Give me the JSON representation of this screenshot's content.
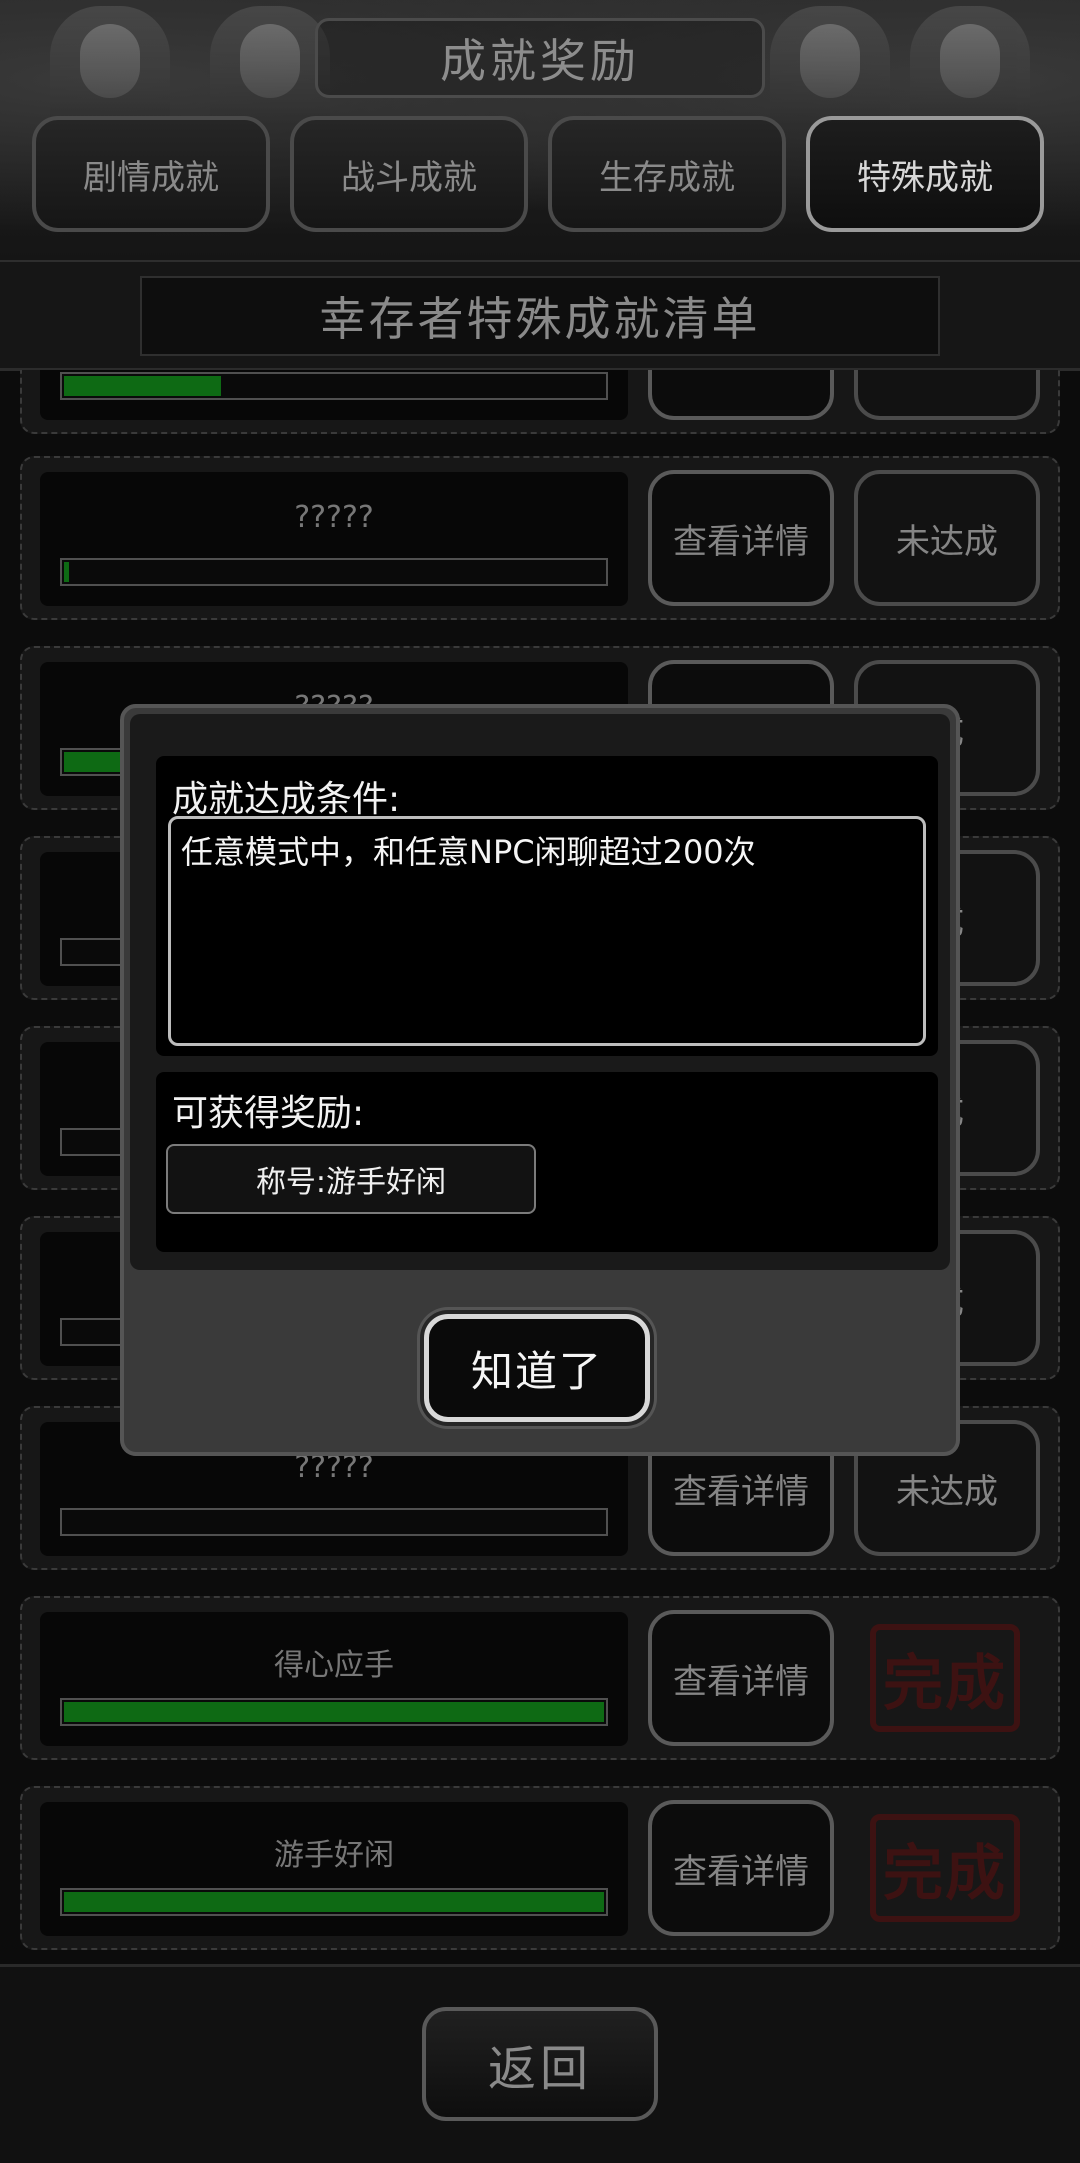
{
  "header": {
    "title": "成就奖励",
    "tabs": [
      {
        "label": "剧情成就",
        "active": false
      },
      {
        "label": "战斗成就",
        "active": false
      },
      {
        "label": "生存成就",
        "active": false
      },
      {
        "label": "特殊成就",
        "active": true
      }
    ],
    "subtitle": "幸存者特殊成就清单"
  },
  "list": {
    "rows": [
      {
        "name": "",
        "progress": 0.29,
        "detail_label": "",
        "status_label": ""
      },
      {
        "name": "?????",
        "progress": 0.01,
        "detail_label": "查看详情",
        "status_label": "未达成"
      },
      {
        "name": "?????",
        "progress": 0.32,
        "detail_label": "",
        "status_label": "成"
      },
      {
        "name": "",
        "progress": 0.0,
        "detail_label": "",
        "status_label": "成"
      },
      {
        "name": "",
        "progress": 0.0,
        "detail_label": "",
        "status_label": "成"
      },
      {
        "name": "",
        "progress": 0.0,
        "detail_label": "",
        "status_label": "成"
      },
      {
        "name": "?????",
        "progress": 0.0,
        "detail_label": "查看详情",
        "status_label": "未达成"
      },
      {
        "name": "得心应手",
        "progress": 1.0,
        "detail_label": "查看详情",
        "stamp": "完成"
      },
      {
        "name": "游手好闲",
        "progress": 1.0,
        "detail_label": "查看详情",
        "stamp": "完成"
      }
    ]
  },
  "dialog": {
    "condition_label": "成就达成条件:",
    "condition_text": "任意模式中，和任意NPC闲聊超过200次",
    "reward_label": "可获得奖励:",
    "reward_item": "称号:游手好闲",
    "ok_label": "知道了"
  },
  "footer": {
    "back_label": "返回"
  },
  "colors": {
    "progress_fill": "#0e6a14",
    "stamp": "#3d1212"
  }
}
